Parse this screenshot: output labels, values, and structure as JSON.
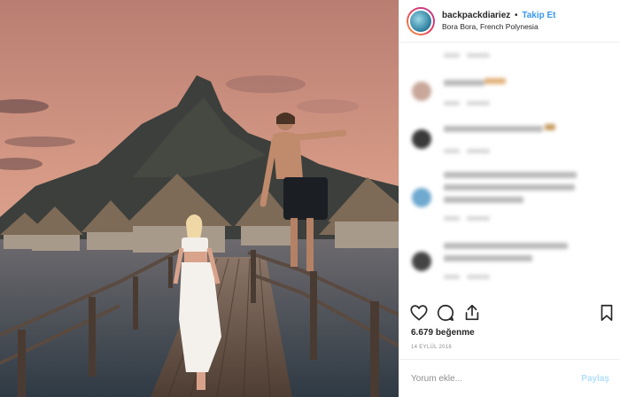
{
  "header": {
    "username": "backpackdiariez",
    "separator": "•",
    "follow_label": "Takip Et",
    "location": "Bora Bora, French Polynesia"
  },
  "icons": {
    "like": "heart-icon",
    "comment": "comment-icon",
    "share": "share-icon",
    "save": "bookmark-icon"
  },
  "stats": {
    "likes_count": "6.679",
    "likes_word": "beğenme",
    "date": "14 EYLÜL 2018"
  },
  "add_comment": {
    "placeholder": "Yorum ekle...",
    "post_label": "Paylaş"
  },
  "colors": {
    "link": "#3897f0",
    "post_disabled": "#b2dffc",
    "border": "#efefef"
  }
}
